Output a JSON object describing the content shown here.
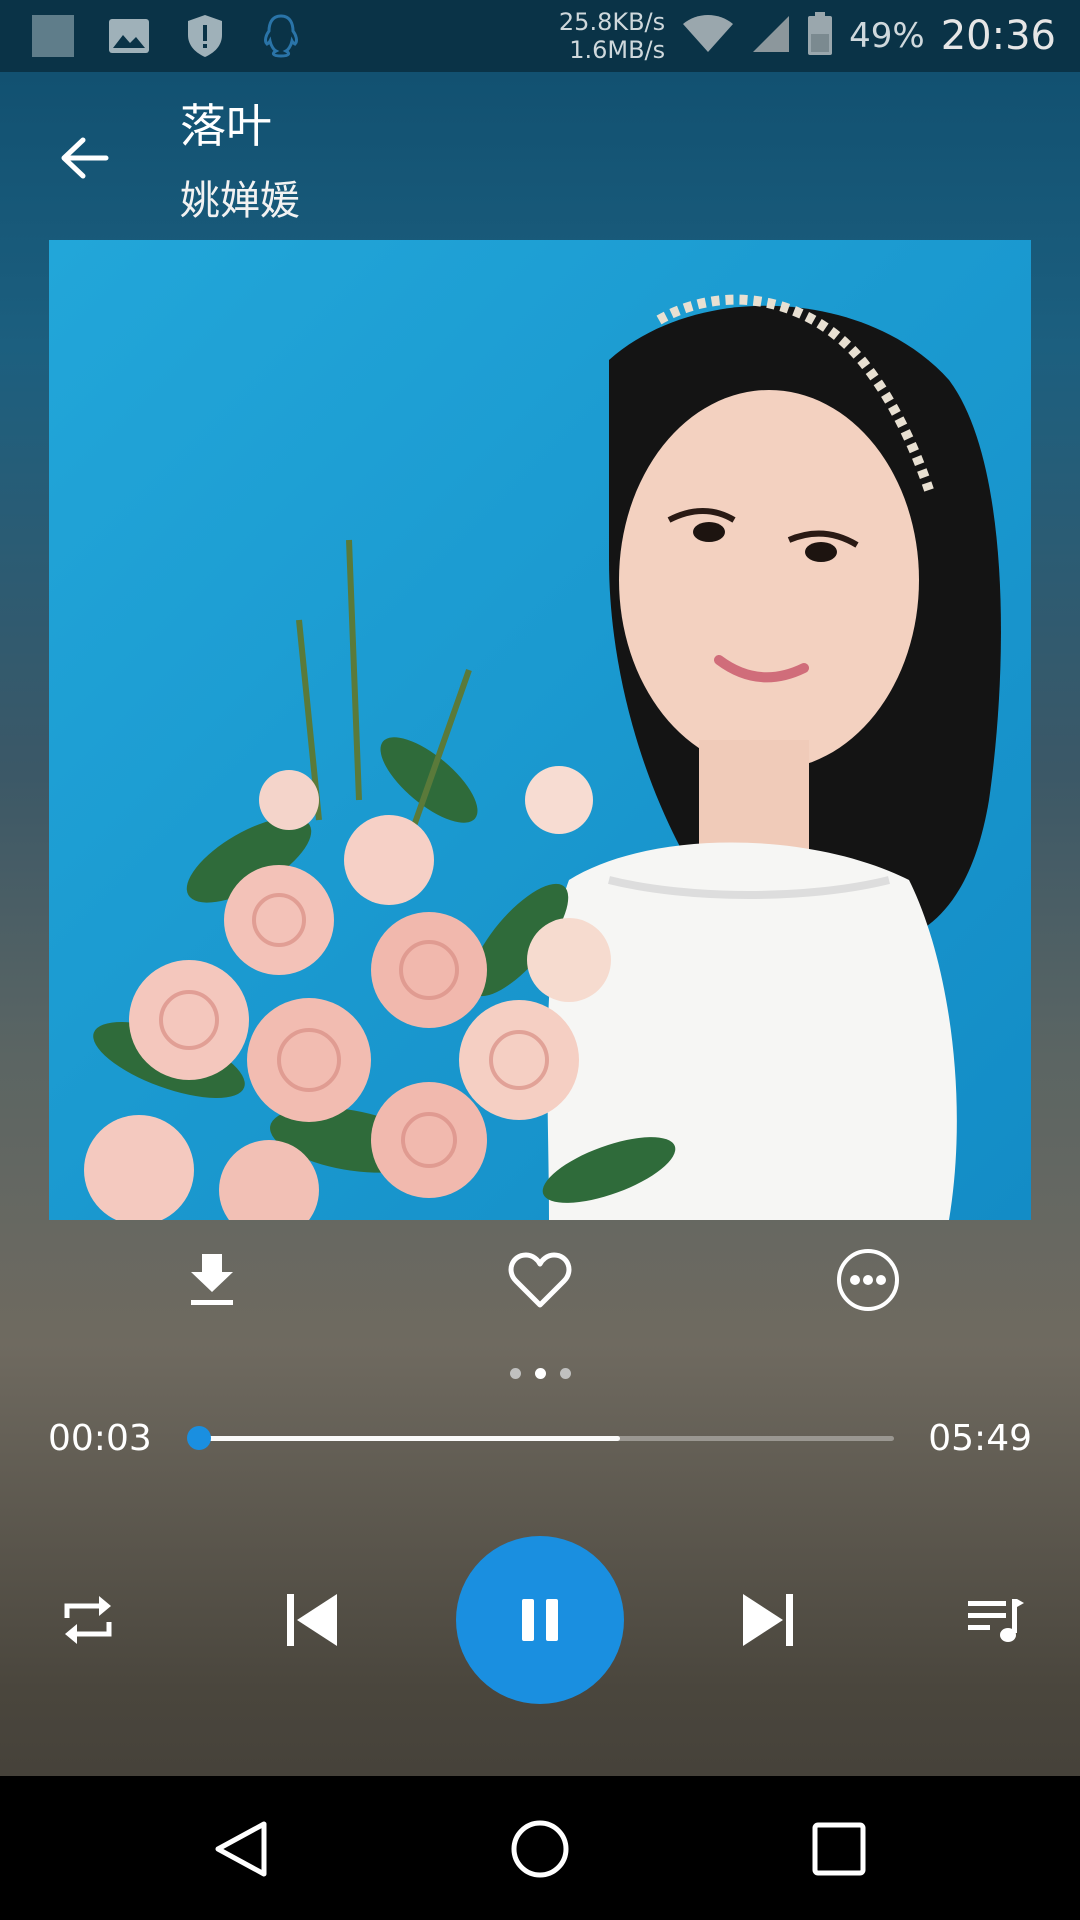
{
  "status_bar": {
    "net_up": "25.8KB/s",
    "net_down": "1.6MB/s",
    "battery_percent": "49%",
    "time": "20:36",
    "icons": [
      "app-icon",
      "gallery-icon",
      "shield-icon",
      "qq-icon",
      "wifi-icon",
      "signal-icon",
      "battery-icon"
    ]
  },
  "song": {
    "title": "落叶",
    "artist": "姚婵媛"
  },
  "actions": [
    "download-icon",
    "heart-icon",
    "more-icon"
  ],
  "pager": {
    "pages": 3,
    "active": 1
  },
  "progress": {
    "current": "00:03",
    "total": "05:49",
    "played_fraction": 0.01,
    "buffered_fraction": 0.61
  },
  "controls": [
    "repeat-icon",
    "previous-icon",
    "pause-icon",
    "next-icon",
    "playlist-icon"
  ],
  "colors": {
    "accent": "#1a8fe0"
  },
  "navigation": [
    "back-icon",
    "home-icon",
    "recents-icon"
  ]
}
